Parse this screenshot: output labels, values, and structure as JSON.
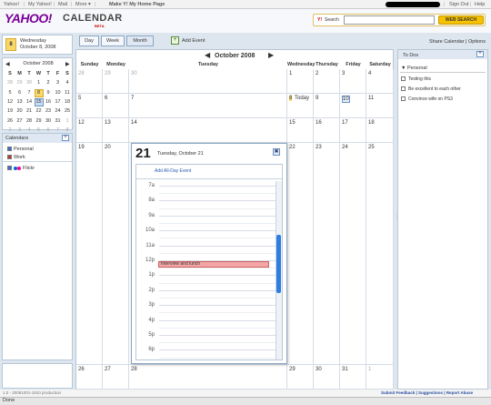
{
  "topnav": {
    "yahoo": "Yahoo!",
    "my_yahoo": "My Yahoo!",
    "mail": "Mail",
    "more": "More",
    "more_arrow": "▾",
    "homepage": "Make Y! My Home Page",
    "sign_out": "Sign Out",
    "help": "Help"
  },
  "header": {
    "logo": "YAHOO!",
    "app_name": "CALENDAR",
    "beta": "BETA",
    "search_label": "Search",
    "search_brand": "Y!",
    "search_value": "",
    "search_button": "WEB SEARCH"
  },
  "today_panel": {
    "day": "8",
    "weekday": "Wednesday",
    "date": "October 8, 2008"
  },
  "mini_calendar": {
    "title": "October 2008",
    "prev": "◀",
    "next": "▶",
    "weekdays": [
      "S",
      "M",
      "T",
      "W",
      "T",
      "F",
      "S"
    ],
    "weeks": [
      [
        "28",
        "29",
        "30",
        "1",
        "2",
        "3",
        "4"
      ],
      [
        "5",
        "6",
        "7",
        "8",
        "9",
        "10",
        "11"
      ],
      [
        "12",
        "13",
        "14",
        "15",
        "16",
        "17",
        "18"
      ],
      [
        "19",
        "20",
        "21",
        "22",
        "23",
        "24",
        "25"
      ],
      [
        "26",
        "27",
        "28",
        "29",
        "30",
        "31",
        "1"
      ],
      [
        "2",
        "3",
        "4",
        "5",
        "6",
        "7",
        "8"
      ]
    ]
  },
  "calendars": {
    "header": "Calendars",
    "add": "+",
    "items": [
      {
        "label": "Personal",
        "color": "#3a6fd1"
      },
      {
        "label": "Work",
        "color": "#c0392b"
      },
      {
        "label": "Flickr",
        "color": "#ff0084"
      }
    ]
  },
  "views": {
    "day": "Day",
    "week": "Week",
    "month": "Month",
    "active": "Month",
    "add_event": "Add Event"
  },
  "month": {
    "title": "October 2008",
    "prev": "◀",
    "next": "▶",
    "weekdays": [
      "Sunday",
      "Monday",
      "Tuesday",
      "Wednesday",
      "Thursday",
      "Friday",
      "Saturday"
    ],
    "weeks": [
      [
        "28",
        "29",
        "30",
        "1",
        "2",
        "3",
        "4"
      ],
      [
        "5",
        "6",
        "7",
        "8",
        "9",
        "10",
        "11"
      ],
      [
        "12",
        "13",
        "14",
        "15",
        "16",
        "17",
        "18"
      ],
      [
        "19",
        "20",
        "21",
        "22",
        "23",
        "24",
        "25"
      ],
      [
        "26",
        "27",
        "28",
        "29",
        "30",
        "31",
        "1"
      ]
    ],
    "today_label": "Today"
  },
  "popup": {
    "day": "21",
    "date": "Tuesday, October 21",
    "close": "✖",
    "all_day_link": "Add All-Day Event",
    "hours": [
      "7a",
      "8a",
      "9a",
      "10a",
      "11a",
      "12p",
      "1p",
      "2p",
      "3p",
      "4p",
      "5p",
      "6p"
    ],
    "event": "Interview and lunch"
  },
  "right": {
    "share": "Share Calendar",
    "options": "Options",
    "todo_header": "To Dos",
    "add": "+",
    "group": "Personal",
    "items": [
      "Testing this",
      "Be excellent to each other",
      "Convince wife on PS3"
    ]
  },
  "footer": {
    "version": "1.0 - 20081001-1910 production",
    "feedback": "Submit Feedback",
    "suggestions": "Suggestions",
    "report": "Report Abuse",
    "status": "Done"
  },
  "colors": {
    "accent": "#2a5db0",
    "today": "#f9d86a",
    "event": "#f2a6a6",
    "logo": "#7b0099"
  }
}
